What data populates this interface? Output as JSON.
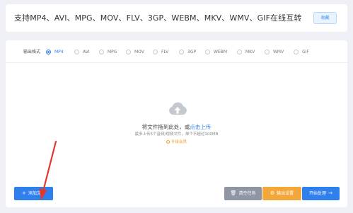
{
  "header": {
    "title": "支持MP4、AVI、MPG、MOV、FLV、3GP、WEBM、MKV、WMV、GIF在线互转",
    "collect_label": "收藏"
  },
  "format_bar": {
    "label": "输出格式",
    "selected": "MP4",
    "options": [
      "MP4",
      "AVI",
      "MPG",
      "MOV",
      "FLV",
      "3GP",
      "WEBM",
      "MKV",
      "WMV",
      "GIF"
    ]
  },
  "drop_zone": {
    "text_prefix": "将文件拖到此处，或",
    "link_text": "点击上传",
    "limit_text": "最多上传5个音频/视频文件，单个不超过100MB",
    "upgrade_text": "升级会员"
  },
  "actions": {
    "add_file": "添加文件",
    "clear_tasks": "清空任务",
    "output_settings": "输出设置",
    "start_process": "开始处理"
  },
  "colors": {
    "accent": "#2f80ed",
    "warning": "#f3a63a",
    "neutral_button": "#8f96a3",
    "annotation_arrow": "#e03a2f"
  }
}
